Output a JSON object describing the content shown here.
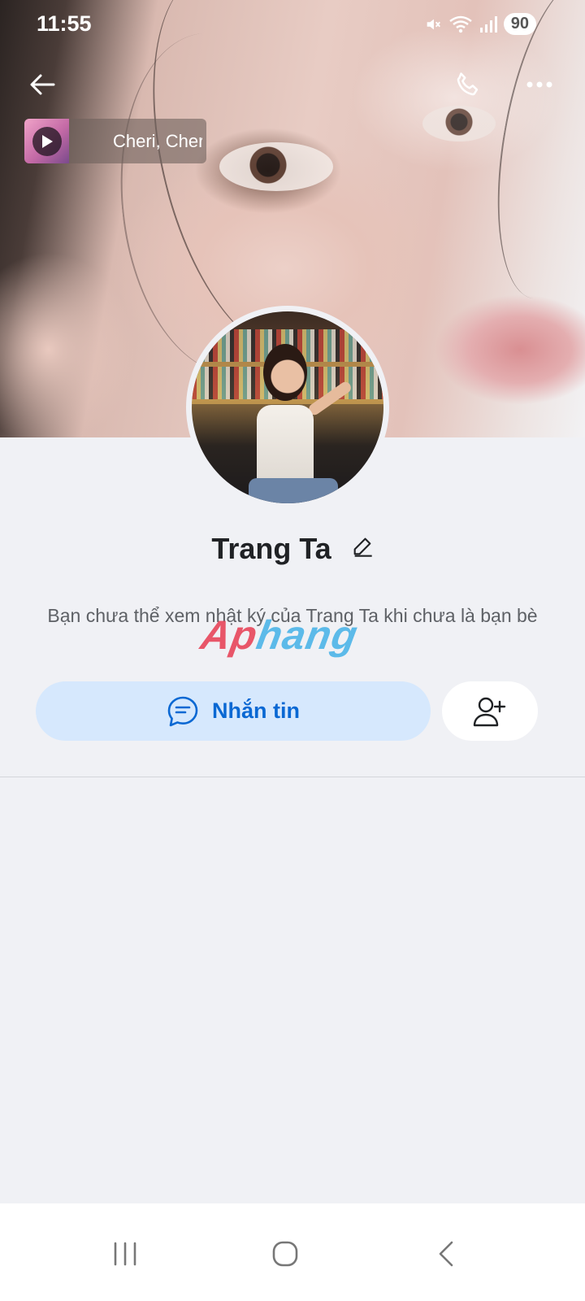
{
  "status_bar": {
    "time": "11:55",
    "battery": "90"
  },
  "now_playing": {
    "title": "Cheri, Cheri Lady"
  },
  "profile": {
    "name": "Trang Ta",
    "privacy_note": "Bạn chưa thể xem nhật ký của Trang Ta khi chưa là bạn bè",
    "watermark_a": "Ap",
    "watermark_b": "hang"
  },
  "actions": {
    "message_label": "Nhắn tin"
  },
  "icons": {
    "back": "arrow-left-icon",
    "call": "phone-icon",
    "more": "more-dots-icon",
    "play": "play-icon",
    "edit": "pencil-icon",
    "message": "chat-bubble-icon",
    "add_friend": "add-user-icon"
  },
  "colors": {
    "accent": "#0a68d3",
    "message_button_bg": "#d6e8fd",
    "page_bg": "#f0f1f5"
  }
}
